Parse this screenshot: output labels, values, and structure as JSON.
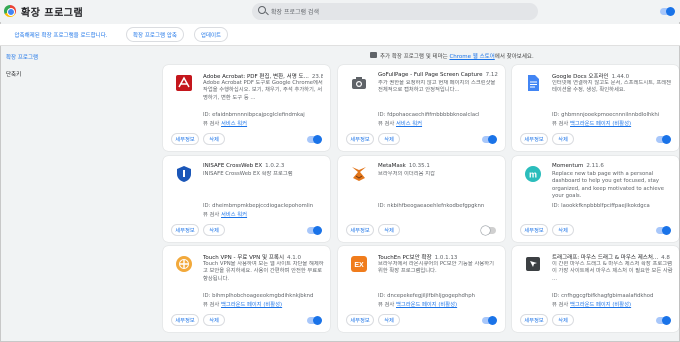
{
  "header": {
    "title": "확장 프로그램",
    "search_placeholder": "확장 프로그램 검색",
    "developer_mode_on": true
  },
  "toolbar": {
    "load_unpacked": "압축해제된 확장 프로그램을 로드합니다.",
    "pack": "확장 프로그램 압축",
    "update": "업데이트"
  },
  "sidebar": {
    "items": [
      {
        "label": "확장 프로그램",
        "active": true
      },
      {
        "label": "단축키",
        "active": false
      }
    ]
  },
  "banner": {
    "prefix": "추가 확장 프로그램 및 테마는 ",
    "link": "Chrome 웹 스토어",
    "suffix": "에서 찾아보세요."
  },
  "card_labels": {
    "details": "세부정보",
    "remove": "삭제",
    "id_prefix": "ID: ",
    "inspect_prefix": "뷰 검사 "
  },
  "cards": [
    {
      "name": "Adobe Acrobat: PDF 편집, 변환, 서명 도...",
      "version": "23.8.1.0",
      "desc": "Adobe Acrobat PDF 도구로 Google Chrome에서 작업을 수행하십시오. 보기, 채우기, 주석 추가하기, 서명하기, 변환 도구 등 ...",
      "id": "efaidnbmnnnibpcajpcglclefindmkaj",
      "inspect": "서비스 워커",
      "enabled": true,
      "icon": "adobe-acrobat-icon",
      "color": "#c4161c"
    },
    {
      "name": "GoFullPage - Full Page Screen Capture",
      "version": "7.12",
      "desc": "추가 권한을 요청하지 않고 현재 페이지의 스크린샷을 전체적으로 캡처하고 안정적입니다...",
      "id": "fdpohaocaechififmbbbbbknoalclacl",
      "inspect": "서비스 워커",
      "enabled": true,
      "icon": "camera-icon",
      "color": "#5f6368"
    },
    {
      "name": "Google Docs 오프라인",
      "version": "1.44.0",
      "desc": "인터넷에 연결하지 않고도 문서, 스프레드시트, 프레젠테이션을 수정, 생성, 확인하세요.",
      "id": "ghbmnnjooekpmoecnnnilnnbdlolhkhi",
      "inspect": "백그라운드 페이지 (비활성)",
      "enabled": true,
      "icon": "google-docs-icon",
      "color": "#4285f4"
    },
    {
      "name": "INISAFE CrossWeb EX",
      "version": "1.0.2.3",
      "desc": "INISAFE CrossWeb EX 확장 프로그램",
      "id": "dheimbmpmkbepjccdiogaclepohomlin",
      "inspect": "서비스 워커",
      "enabled": true,
      "icon": "shield-icon",
      "color": "#1a56b8"
    },
    {
      "name": "MetaMask",
      "version": "10.35.1",
      "desc": "브라우저의 이더리움 지갑",
      "id": "nkbihfbeogaeaoehlefnkodbefgpgknn",
      "inspect": "",
      "enabled": false,
      "icon": "metamask-fox-icon",
      "color": "#e2761b"
    },
    {
      "name": "Momentum",
      "version": "2.11.6",
      "desc": "Replace new tab page with a personal dashboard to help you get focused, stay organized, and keep motivated to achieve your goals.",
      "id": "laookkfknpbbblfpciffpaejlkokdgca",
      "inspect": "",
      "enabled": true,
      "icon": "momentum-icon",
      "color": "#2bbdbc"
    },
    {
      "name": "Touch VPN - 무료 VPN 및 프록시",
      "version": "4.1.0",
      "desc": "Touch VPN을 사용하여 모든 웹 사이트 차단을 해제하고 보안을 유지하세요. 사용이 간편하며 안전한 무료로 향상됩니다.",
      "id": "bihmplhobchoageeokmgbdihknkjbknd",
      "inspect": "백그라운드 페이지 (비활성)",
      "enabled": true,
      "icon": "touch-vpn-icon",
      "color": "#f2a93b"
    },
    {
      "name": "TouchEn PC보안 확장",
      "version": "1.0.1.13",
      "desc": "브라우저에서 라온시큐어의 PC보안 기능을 사용하기 위한 확장 프로그램입니다.",
      "id": "dncepekefegjiljlfbihljgogephdhph",
      "inspect": "백그라운드 페이지 (비활성)",
      "enabled": true,
      "icon": "touchen-icon",
      "color": "#f07c1c"
    },
    {
      "name": "트래그래프: 마우스 드래그 & 마우스 제스처...",
      "version": "4.8",
      "desc": "이 간편 마우스 드래그 & 마우스 제스처 확장 프로그램이 가장 사이트에서 마우스 제스처 이 필요한 모든 사람 ...",
      "id": "cnfhggcgfbifkhagfgbimaalafidkhod",
      "inspect": "백그라운드 페이지 (비활성)",
      "enabled": true,
      "icon": "drag-gesture-icon",
      "color": "#3c4043"
    }
  ]
}
